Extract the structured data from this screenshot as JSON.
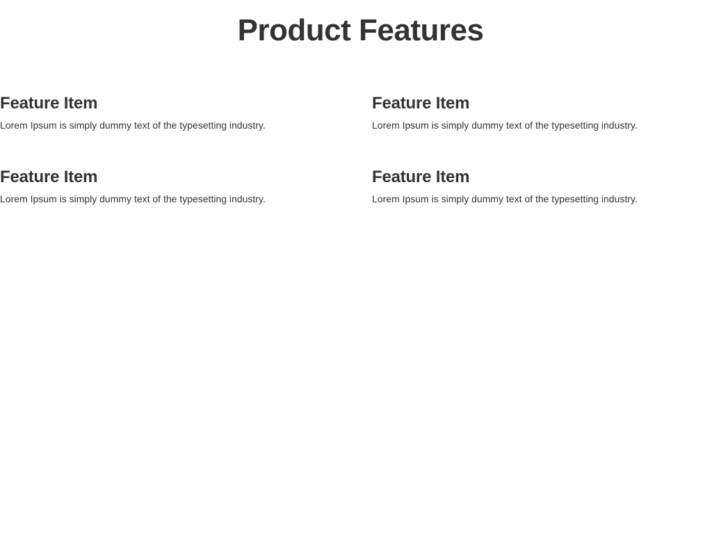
{
  "header": {
    "title": "Product Features"
  },
  "features": [
    {
      "title": "Feature Item",
      "description": "Lorem Ipsum is simply dummy text of the typesetting industry."
    },
    {
      "title": "Feature Item",
      "description": "Lorem Ipsum is simply dummy text of the typesetting industry."
    },
    {
      "title": "Feature Item",
      "description": "Lorem Ipsum is simply dummy text of the typesetting industry."
    },
    {
      "title": "Feature Item",
      "description": "Lorem Ipsum is simply dummy text of the typesetting industry."
    }
  ]
}
